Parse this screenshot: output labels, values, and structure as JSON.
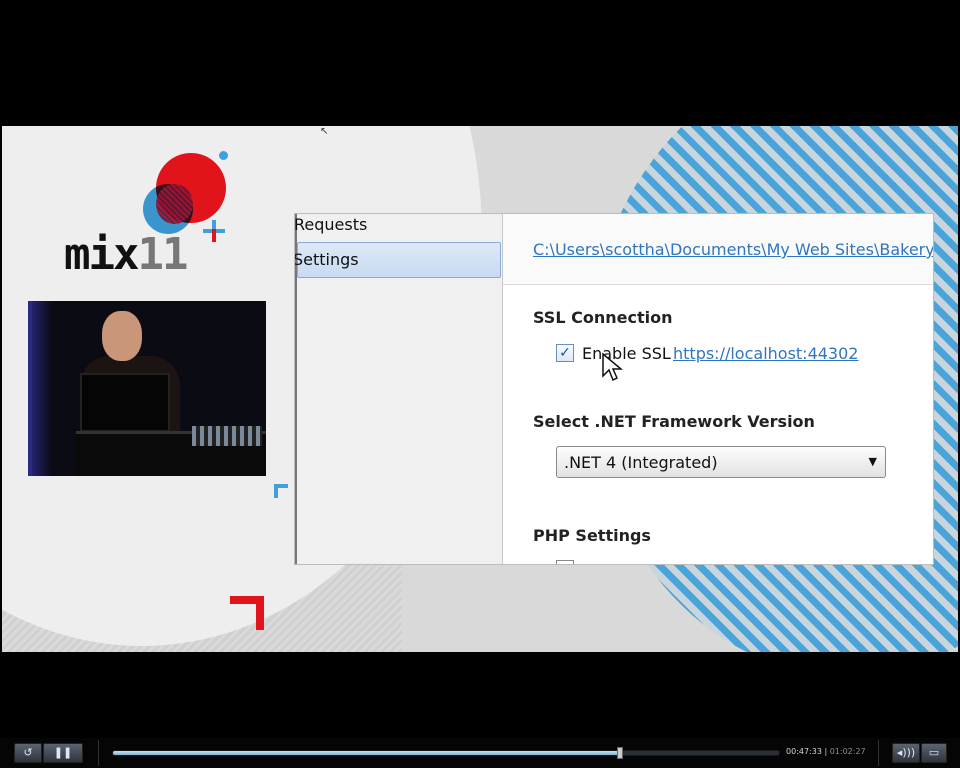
{
  "video": {
    "logo_text_main": "mix",
    "logo_text_num": "11",
    "dialog": {
      "left_items": [
        "Requests",
        "Settings"
      ],
      "selected_item": "Settings",
      "path": "C:\\Users\\scottha\\Documents\\My Web Sites\\Bakery",
      "ssl_section": "SSL Connection",
      "enable_ssl_label": "Enable SSL",
      "enable_ssl_checked": true,
      "ssl_url": "https://localhost:44302",
      "net_section": "Select .NET Framework Version",
      "net_selected": ".NET 4 (Integrated)",
      "php_section": "PHP Settings"
    }
  },
  "player": {
    "current_time": "00:47:33",
    "total_time": "01:02:27",
    "progress": 0.7614,
    "icons": {
      "replay": "replay-icon",
      "pause": "pause-icon",
      "volume": "volume-icon",
      "fullscreen": "fullscreen-icon"
    }
  },
  "colors": {
    "accent_red": "#e2141b",
    "accent_blue": "#3ea0dc",
    "link_blue": "#2f75c0"
  }
}
